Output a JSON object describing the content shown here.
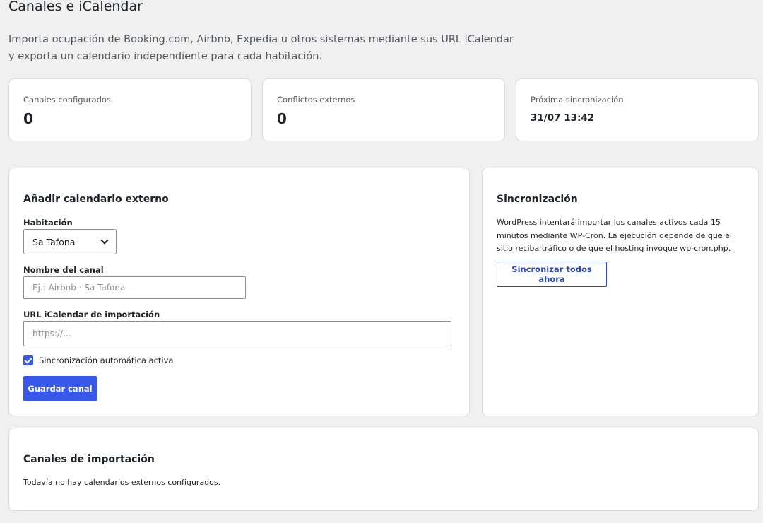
{
  "page": {
    "title": "Canales e iCalendar",
    "intro": "Importa ocupación de Booking.com, Airbnb, Expedia u otros sistemas mediante sus URL iCalendar y exporta un calendario independiente para cada habitación."
  },
  "stats": [
    {
      "label": "Canales configurados",
      "value": "0"
    },
    {
      "label": "Conflictos externos",
      "value": "0"
    },
    {
      "label": "Próxima sincronización",
      "value": "31/07 13:42"
    }
  ],
  "add_form": {
    "title": "Añadir calendario externo",
    "room_label": "Habitación",
    "room_selected": "Sa Tafona",
    "channel_name_label": "Nombre del canal",
    "channel_name_placeholder": "Ej.: Airbnb · Sa Tafona",
    "url_label": "URL iCalendar de importación",
    "url_placeholder": "https://...",
    "auto_sync_label": "Sincronización automática activa",
    "auto_sync_checked": true,
    "save_label": "Guardar canal"
  },
  "sync": {
    "title": "Sincronización",
    "description": "WordPress intentará importar los canales activos cada 15 minutos mediante WP-Cron. La ejecución depende de que el sitio reciba tráfico o de que el hosting invoque wp-cron.php.",
    "button_label": "Sincronizar todos ahora"
  },
  "import_channels": {
    "title": "Canales de importación",
    "empty_text": "Todavía no hay calendarios externos configurados."
  },
  "colors": {
    "accent": "#3858e9",
    "background": "#f0f0f1"
  }
}
